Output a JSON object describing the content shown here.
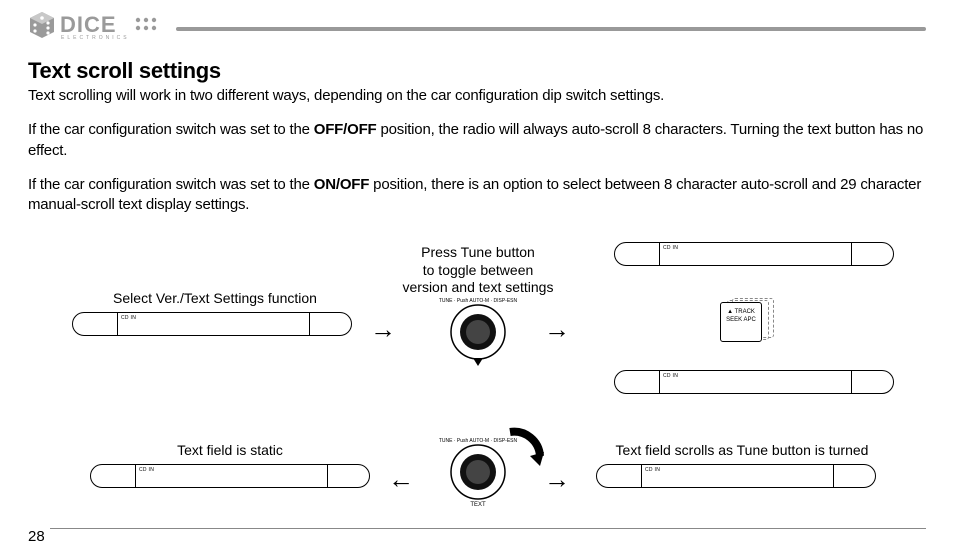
{
  "brand": {
    "name": "DICE",
    "sub": "ELECTRONICS"
  },
  "page_number": "28",
  "title": "Text scroll settings",
  "para1": "Text scrolling will work in two different ways, depending on the car configuration dip switch settings.",
  "para2_a": "If the car configuration switch was set to the ",
  "para2_bold": "OFF/OFF",
  "para2_b": " position, the radio will always auto-scroll 8 characters. Turning the text button has no effect.",
  "para3_a": "If the car configuration switch was set to the ",
  "para3_bold": "ON/OFF",
  "para3_b": " position, there is an option to select between 8 character auto-scroll and 29 character manual-scroll text display settings.",
  "captions": {
    "c1": "Select Ver./Text Settings function",
    "c2_l1": "Press Tune button",
    "c2_l2": "to toggle between",
    "c2_l3": "version and text settings",
    "c3": "Text field is static",
    "c4": "Text field scrolls as Tune button is turned",
    "knob": "TUNE · Push AUTO-M · DISP-ESN",
    "knob2_bottom": "TEXT",
    "track1": "▲  TRACK",
    "track2": "SEEK APC",
    "cdin": "CD IN"
  }
}
